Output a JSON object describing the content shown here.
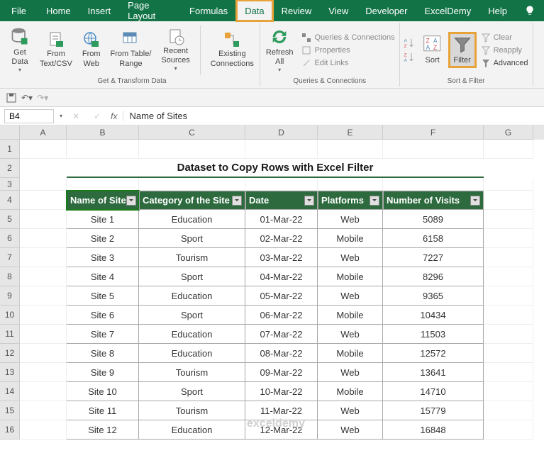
{
  "tabs": {
    "file": "File",
    "home": "Home",
    "insert": "Insert",
    "page_layout": "Page Layout",
    "formulas": "Formulas",
    "data": "Data",
    "review": "Review",
    "view": "View",
    "developer": "Developer",
    "exceldemy": "ExcelDemy",
    "help": "Help"
  },
  "ribbon": {
    "get_data": "Get\nData",
    "from_text": "From\nText/CSV",
    "from_web": "From\nWeb",
    "from_table": "From Table/\nRange",
    "recent_sources": "Recent\nSources",
    "existing_conn": "Existing\nConnections",
    "group1": "Get & Transform Data",
    "refresh_all": "Refresh\nAll",
    "queries_conn": "Queries & Connections",
    "properties": "Properties",
    "edit_links": "Edit Links",
    "group2": "Queries & Connections",
    "sort": "Sort",
    "filter": "Filter",
    "clear": "Clear",
    "reapply": "Reapply",
    "advanced": "Advanced",
    "group3": "Sort & Filter"
  },
  "formula_bar": {
    "cell_ref": "B4",
    "content": "Name of Sites"
  },
  "columns": [
    "A",
    "B",
    "C",
    "D",
    "E",
    "F",
    "G"
  ],
  "sheet": {
    "title": "Dataset to Copy Rows with Excel Filter",
    "headers": {
      "name": "Name of Site",
      "category": "Category of the Site",
      "date": "Date",
      "platforms": "Platforms",
      "visits": "Number of Visits"
    },
    "rows": [
      {
        "n": 5,
        "name": "Site 1",
        "cat": "Education",
        "date": "01-Mar-22",
        "plat": "Web",
        "vis": "5089"
      },
      {
        "n": 6,
        "name": "Site 2",
        "cat": "Sport",
        "date": "02-Mar-22",
        "plat": "Mobile",
        "vis": "6158"
      },
      {
        "n": 7,
        "name": "Site 3",
        "cat": "Tourism",
        "date": "03-Mar-22",
        "plat": "Web",
        "vis": "7227"
      },
      {
        "n": 8,
        "name": "Site 4",
        "cat": "Sport",
        "date": "04-Mar-22",
        "plat": "Mobile",
        "vis": "8296"
      },
      {
        "n": 9,
        "name": "Site 5",
        "cat": "Education",
        "date": "05-Mar-22",
        "plat": "Web",
        "vis": "9365"
      },
      {
        "n": 10,
        "name": "Site 6",
        "cat": "Sport",
        "date": "06-Mar-22",
        "plat": "Mobile",
        "vis": "10434"
      },
      {
        "n": 11,
        "name": "Site 7",
        "cat": "Education",
        "date": "07-Mar-22",
        "plat": "Web",
        "vis": "11503"
      },
      {
        "n": 12,
        "name": "Site 8",
        "cat": "Education",
        "date": "08-Mar-22",
        "plat": "Mobile",
        "vis": "12572"
      },
      {
        "n": 13,
        "name": "Site 9",
        "cat": "Tourism",
        "date": "09-Mar-22",
        "plat": "Web",
        "vis": "13641"
      },
      {
        "n": 14,
        "name": "Site 10",
        "cat": "Sport",
        "date": "10-Mar-22",
        "plat": "Mobile",
        "vis": "14710"
      },
      {
        "n": 15,
        "name": "Site 11",
        "cat": "Tourism",
        "date": "11-Mar-22",
        "plat": "Web",
        "vis": "15779"
      },
      {
        "n": 16,
        "name": "Site 12",
        "cat": "Education",
        "date": "12-Mar-22",
        "plat": "Web",
        "vis": "16848"
      }
    ]
  },
  "watermark": "exceldemy"
}
